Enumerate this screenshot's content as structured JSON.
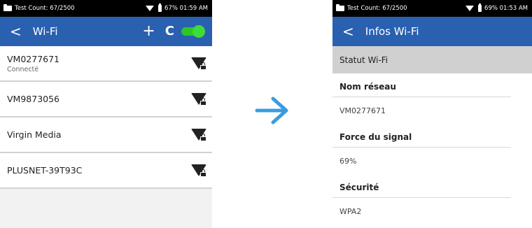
{
  "left_screen": {
    "status_bar": {
      "test_count": "Test Count: 67/2500",
      "battery_time": "67% 01:59 AM"
    },
    "app_bar": {
      "back_glyph": "<",
      "title": "Wi-Fi",
      "add_glyph": "+",
      "refresh_glyph": "C",
      "wifi_toggle_on": true
    },
    "networks": [
      {
        "name": "VM0277671",
        "status": "Connecté"
      },
      {
        "name": "VM9873056",
        "status": ""
      },
      {
        "name": "Virgin Media",
        "status": ""
      },
      {
        "name": "PLUSNET-39T93C",
        "status": ""
      }
    ]
  },
  "right_screen": {
    "status_bar": {
      "test_count": "Test Count: 67/2500",
      "battery_time": "69% 01:53 AM"
    },
    "app_bar": {
      "back_glyph": "<",
      "title": "Infos Wi-Fi"
    },
    "section_header": "Statut Wi-Fi",
    "fields": [
      {
        "label": "Nom réseau",
        "value": "VM0277671"
      },
      {
        "label": "Force du signal",
        "value": "69%"
      },
      {
        "label": "Sécurité",
        "value": "WPA2"
      }
    ]
  },
  "colors": {
    "app_bar": "#2a60b0",
    "toggle_on": "#3ddc38",
    "arrow": "#3a9be0",
    "section_header_bg": "#d0d0d0"
  },
  "icons": [
    "folder-icon",
    "wifi-status-icon",
    "battery-icon",
    "back-icon",
    "plus-icon",
    "refresh-icon",
    "toggle-switch",
    "wifi-lock-icon",
    "right-arrow-icon"
  ]
}
